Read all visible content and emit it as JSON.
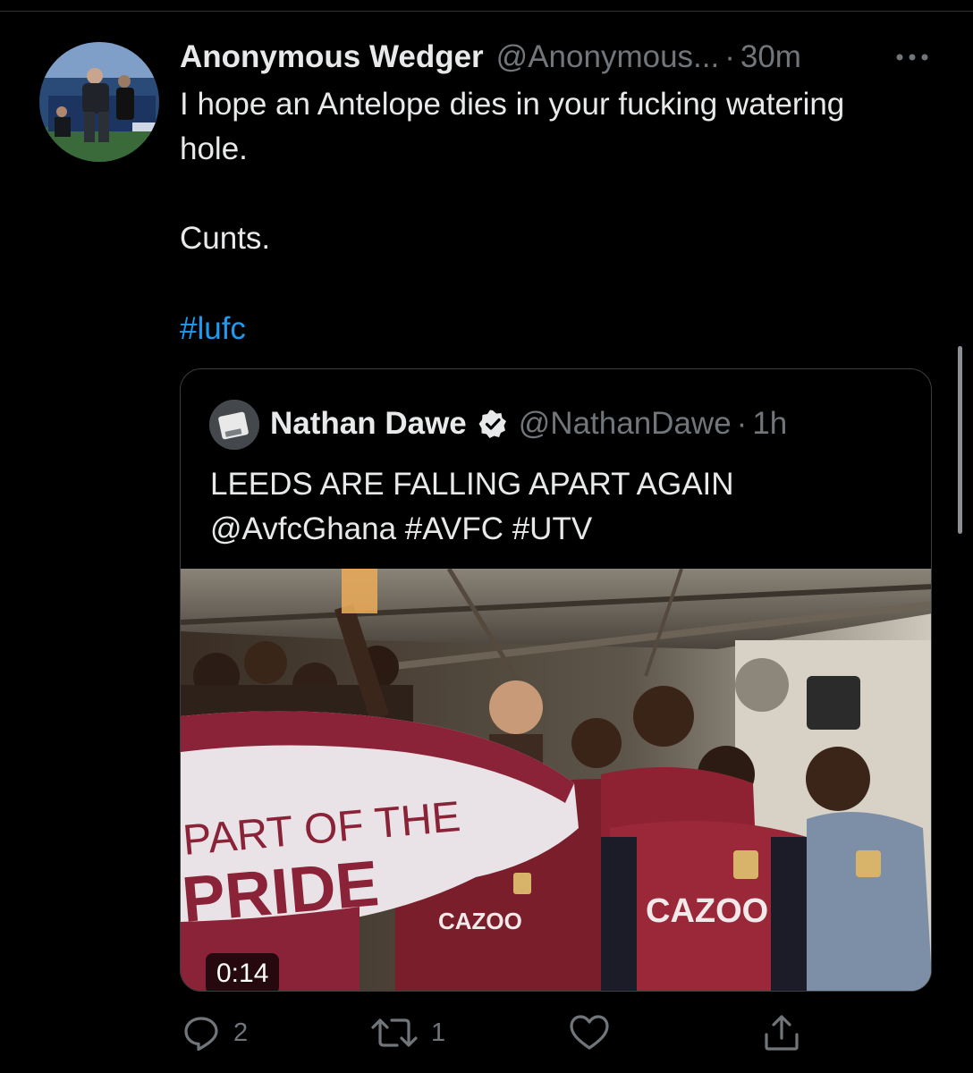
{
  "tweet": {
    "author_name": "Anonymous Wedger",
    "author_handle": "@Anonymous...",
    "separator": "·",
    "time": "30m",
    "text": "I hope an Antelope dies in your fucking watering\nhole.\n\nCunts.",
    "hashtag": "#lufc"
  },
  "quoted_tweet": {
    "author_name": "Nathan Dawe",
    "author_handle": "@NathanDawe",
    "separator": "·",
    "time": "1h",
    "verified": true,
    "text": "LEEDS ARE FALLING APART AGAIN\n@AvfcGhana #AVFC #UTV",
    "video_duration": "0:14",
    "banner_text_line1": "PART OF THE",
    "banner_text_line2": "PRIDE",
    "shirt_sponsor": "CAZOO"
  },
  "actions": {
    "reply_count": "2",
    "retweet_count": "1"
  },
  "icons": {
    "more": "more-horizontal-icon",
    "reply": "reply-icon",
    "retweet": "retweet-icon",
    "like": "heart-icon",
    "share": "share-icon",
    "verified": "verified-badge-icon"
  },
  "colors": {
    "background": "#000000",
    "text": "#e7e9ea",
    "muted": "#71767b",
    "link": "#1d9bf0",
    "border": "#3a3e42"
  }
}
